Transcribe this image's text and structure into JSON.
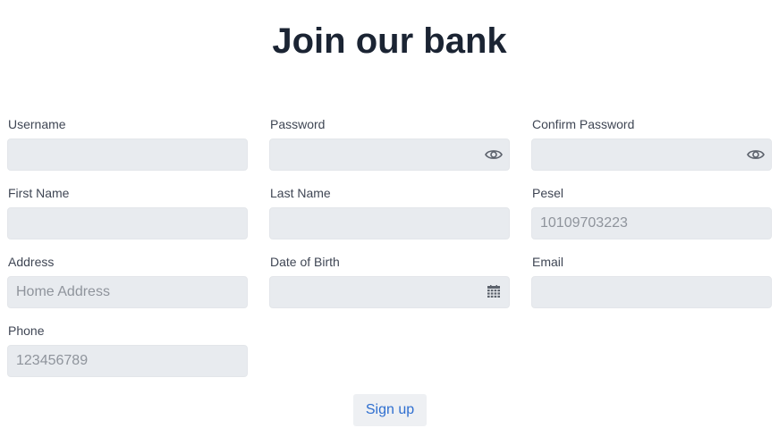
{
  "header": {
    "title": "Join our bank"
  },
  "form": {
    "username": {
      "label": "Username",
      "value": "",
      "placeholder": ""
    },
    "password": {
      "label": "Password",
      "value": "",
      "placeholder": "",
      "icon": "eye-icon"
    },
    "confirm_password": {
      "label": "Confirm Password",
      "value": "",
      "placeholder": "",
      "icon": "eye-icon"
    },
    "first_name": {
      "label": "First Name",
      "value": "",
      "placeholder": ""
    },
    "last_name": {
      "label": "Last Name",
      "value": "",
      "placeholder": ""
    },
    "pesel": {
      "label": "Pesel",
      "value": "",
      "placeholder": "10109703223"
    },
    "address": {
      "label": "Address",
      "value": "",
      "placeholder": "Home Address"
    },
    "date_of_birth": {
      "label": "Date of Birth",
      "value": "",
      "placeholder": "",
      "icon": "calendar-icon"
    },
    "email": {
      "label": "Email",
      "value": "",
      "placeholder": ""
    },
    "phone": {
      "label": "Phone",
      "value": "",
      "placeholder": "123456789"
    },
    "submit_label": "Sign up"
  },
  "colors": {
    "title": "#1b2433",
    "input_background": "#e8ebef",
    "label": "#3f4654",
    "button_text": "#2f6fd0",
    "button_background": "#eef0f3"
  }
}
